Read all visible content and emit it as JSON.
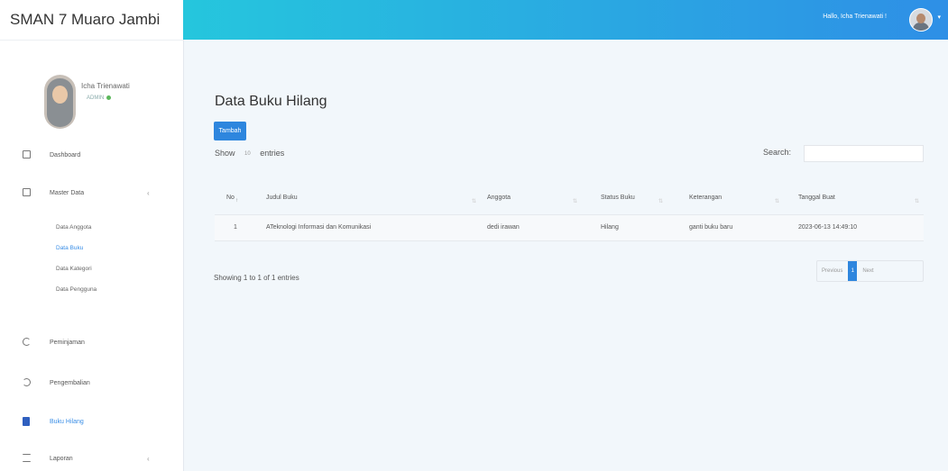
{
  "brand": "SMAN 7 Muaro Jambi",
  "profile": {
    "name": "Icha Trienawati",
    "role": "ADMIN"
  },
  "nav": [
    {
      "label": "Dashboard",
      "icon": "monitor-icon"
    },
    {
      "label": "Master Data",
      "icon": "copy-icon",
      "caret": "‹"
    },
    {
      "label": "Peminjaman",
      "icon": "refresh-icon"
    },
    {
      "label": "Pengembalian",
      "icon": "undo-icon"
    },
    {
      "label": "Buku Hilang",
      "icon": "book-icon"
    },
    {
      "label": "Laporan",
      "icon": "list-icon",
      "caret": "‹"
    }
  ],
  "sub_nav": [
    "Data Anggota",
    "Data Buku",
    "Data Kategori",
    "Data Pengguna"
  ],
  "topbar": {
    "greeting": "Hallo, Icha Trienawati !",
    "caret": "▾"
  },
  "page": {
    "title": "Data Buku Hilang",
    "add_button": "Tambah",
    "show_label": "Show",
    "entries_select": "10",
    "entries_label": "entries",
    "search_label": "Search:"
  },
  "table": {
    "columns": [
      "No",
      "Judul Buku",
      "Anggota",
      "Status Buku",
      "Keterangan",
      "Tanggal Buat"
    ],
    "rows": [
      [
        "1",
        "ATeknologi Informasi dan Komunikasi",
        "dedi irawan",
        "Hilang",
        "ganti buku baru",
        "2023-06-13 14:49:10"
      ]
    ]
  },
  "info": "Showing 1 to 1 of 1 entries",
  "pagination": {
    "previous": "Previous",
    "current": "1",
    "next": "Next"
  }
}
